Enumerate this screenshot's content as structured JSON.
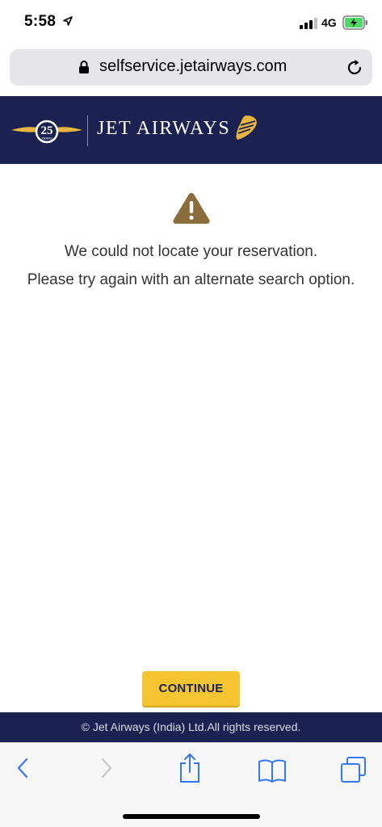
{
  "status_bar": {
    "time": "5:58",
    "network": "4G",
    "icons": [
      "location-arrow-icon",
      "signal-icon",
      "battery-charging-icon"
    ]
  },
  "browser": {
    "url": "selfservice.jetairways.com",
    "icons": [
      "lock-icon",
      "reload-icon"
    ]
  },
  "header": {
    "brand_name": "JET AIRWAYS",
    "emblem_number": "25",
    "emblem_caption": "YEARS",
    "colors": {
      "navy": "#1b2251",
      "gold": "#e8b640"
    }
  },
  "content": {
    "icon": "warning-icon",
    "icon_color": "#8a6d3b",
    "message_line1": "We could not locate your reservation.",
    "message_line2": "Please try again with an alternate search option.",
    "continue_label": "CONTINUE",
    "button_color": "#f5c431"
  },
  "footer": {
    "copyright": "© Jet Airways (India) Ltd.All rights reserved."
  },
  "toolbar": {
    "buttons": [
      "back-icon",
      "forward-icon",
      "share-icon",
      "bookmarks-icon",
      "tabs-icon"
    ]
  }
}
